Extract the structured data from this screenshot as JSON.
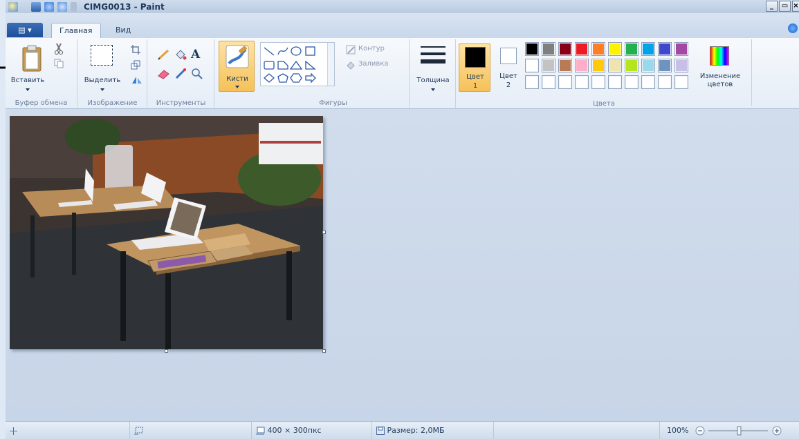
{
  "window": {
    "title": "CIMG0013 - Paint",
    "min": "_",
    "max": "▭",
    "close": "×"
  },
  "tabs": {
    "file": "▤ ▾",
    "home": "Главная",
    "view": "Вид"
  },
  "clipboard": {
    "paste": "Вставить",
    "group": "Буфер обмена"
  },
  "image": {
    "select": "Выделить",
    "group": "Изображение"
  },
  "tools": {
    "text_icon": "A",
    "group": "Инструменты"
  },
  "brushes": {
    "label": "Кисти"
  },
  "shapes": {
    "outline": "Контур",
    "fill": "Заливка",
    "group": "Фигуры"
  },
  "size": {
    "label": "Толщина"
  },
  "colors": {
    "color1_label": "Цвет",
    "color1_num": "1",
    "color2_label": "Цвет",
    "color2_num": "2",
    "edit_label_1": "Изменение",
    "edit_label_2": "цветов",
    "group": "Цвета",
    "color1_value": "#000000",
    "color2_value": "#ffffff",
    "row1": [
      "#000000",
      "#7f7f7f",
      "#880015",
      "#ed1c24",
      "#ff7f27",
      "#fff200",
      "#22b14c",
      "#00a2e8",
      "#3f48cc",
      "#a349a4"
    ],
    "row2": [
      "#ffffff",
      "#c3c3c3",
      "#b97a57",
      "#ffaec9",
      "#ffc90e",
      "#efe4b0",
      "#b5e61d",
      "#99d9ea",
      "#7092be",
      "#c8bfe7"
    ],
    "row3": [
      "#ffffff",
      "#ffffff",
      "#ffffff",
      "#ffffff",
      "#ffffff",
      "#ffffff",
      "#ffffff",
      "#ffffff",
      "#ffffff",
      "#ffffff"
    ]
  },
  "status": {
    "image_size": "400 × 300пкс",
    "file_size": "Размер: 2,0МБ",
    "zoom": "100%"
  }
}
